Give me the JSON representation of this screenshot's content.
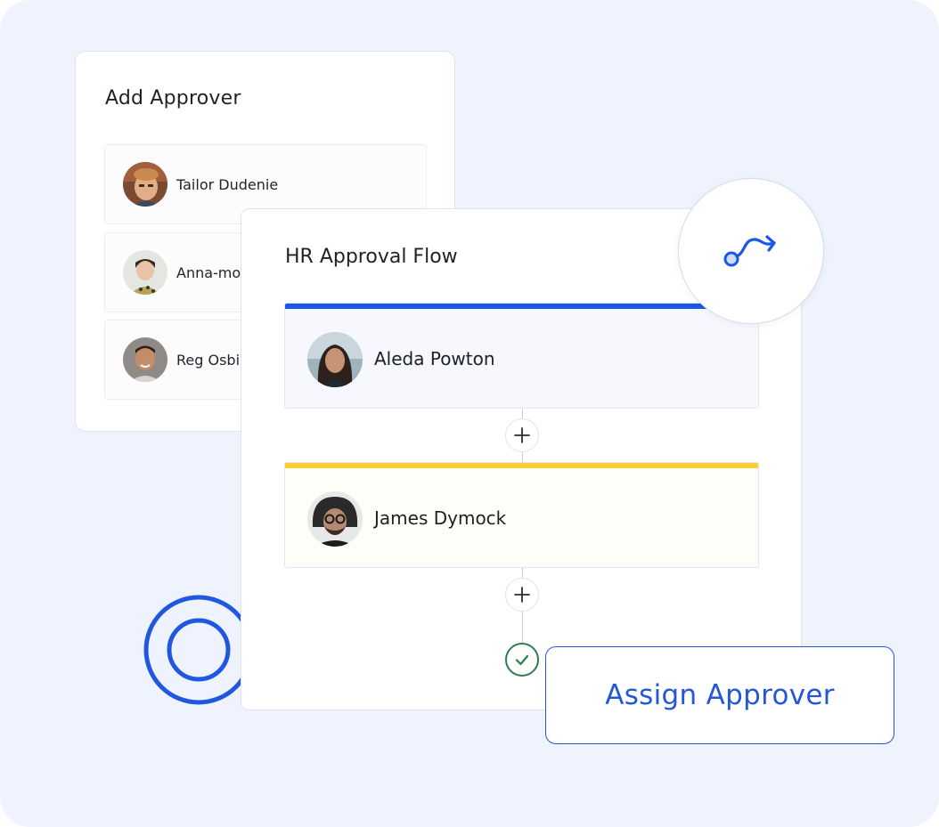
{
  "add_approver": {
    "title": "Add Approver",
    "items": [
      {
        "name": "Tailor Dudenie"
      },
      {
        "name": "Anna-mo"
      },
      {
        "name": "Reg Osbi"
      }
    ]
  },
  "flow": {
    "title": "HR Approval Flow",
    "route_icon": "route-icon",
    "stages": [
      {
        "name": "Aleda Powton",
        "accent": "#1a56e8",
        "background": "#f6f8fd"
      },
      {
        "name": "James Dymock",
        "accent": "#f7cf32",
        "background": "#fffdf7"
      }
    ],
    "add_step_icon": "plus-icon",
    "complete_icon": "check-icon"
  },
  "assign": {
    "label": "Assign Approver"
  },
  "colors": {
    "page_background": "#eff3fd",
    "brand_blue": "#2457d8",
    "success_green": "#2e7d4f"
  }
}
